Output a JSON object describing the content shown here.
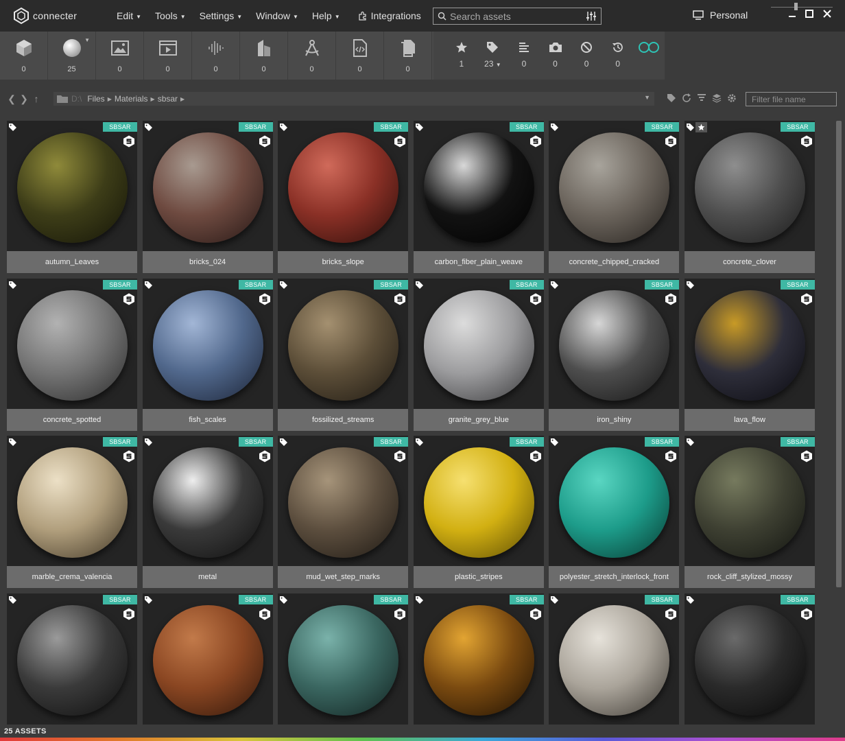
{
  "app": {
    "name": "connecter",
    "menu": [
      {
        "label": "Edit"
      },
      {
        "label": "Tools"
      },
      {
        "label": "Settings"
      },
      {
        "label": "Window"
      },
      {
        "label": "Help"
      }
    ],
    "integrations_label": "Integrations",
    "search_placeholder": "Search assets",
    "account_label": "Personal"
  },
  "toolbar": {
    "categories": [
      {
        "icon": "cube-icon",
        "count": "0"
      },
      {
        "icon": "material-sphere-icon",
        "count": "25"
      },
      {
        "icon": "image-icon",
        "count": "0"
      },
      {
        "icon": "video-icon",
        "count": "0"
      },
      {
        "icon": "audio-icon",
        "count": "0"
      },
      {
        "icon": "building-icon",
        "count": "0"
      },
      {
        "icon": "drafting-compass-icon",
        "count": "0"
      },
      {
        "icon": "code-file-icon",
        "count": "0"
      },
      {
        "icon": "documents-icon",
        "count": "0"
      }
    ],
    "filters": [
      {
        "icon": "star-icon",
        "count": "1"
      },
      {
        "icon": "tag-icon",
        "count": "23"
      },
      {
        "icon": "list-icon",
        "count": "0"
      },
      {
        "icon": "camera-icon",
        "count": "0"
      },
      {
        "icon": "block-icon",
        "count": "0"
      },
      {
        "icon": "history-icon",
        "count": "0"
      },
      {
        "icon": "infinity-icon",
        "count": ""
      }
    ]
  },
  "navigation": {
    "path_hidden": "D:\\",
    "path": [
      "Files",
      "Materials",
      "sbsar"
    ],
    "filter_placeholder": "Filter file name"
  },
  "assets": {
    "badge": "SBSAR",
    "items": [
      {
        "name": "autumn_Leaves",
        "starred": false,
        "c1": "#8f8a3a",
        "c2": "#3d3d18",
        "c3": "#141407"
      },
      {
        "name": "bricks_024",
        "starred": false,
        "c1": "#a89a90",
        "c2": "#6e4a40",
        "c3": "#241614"
      },
      {
        "name": "bricks_slope",
        "starred": false,
        "c1": "#d06a5a",
        "c2": "#8a3026",
        "c3": "#2c0e0a"
      },
      {
        "name": "carbon_fiber_plain_weave",
        "starred": false,
        "c1": "#d8d8d8",
        "c2": "#121212",
        "c3": "#000000"
      },
      {
        "name": "concrete_chipped_cracked",
        "starred": false,
        "c1": "#a8a49c",
        "c2": "#6b645c",
        "c3": "#26221e"
      },
      {
        "name": "concrete_clover",
        "starred": true,
        "c1": "#8e8e8e",
        "c2": "#4e4e4e",
        "c3": "#1a1a1a"
      },
      {
        "name": "concrete_spotted",
        "starred": false,
        "c1": "#b2b2b2",
        "c2": "#747474",
        "c3": "#2a2a2a"
      },
      {
        "name": "fish_scales",
        "starred": false,
        "c1": "#a2b6d6",
        "c2": "#51688c",
        "c3": "#1a2234"
      },
      {
        "name": "fossilized_streams",
        "starred": false,
        "c1": "#a49070",
        "c2": "#5c4e38",
        "c3": "#1e1912"
      },
      {
        "name": "granite_grey_blue",
        "starred": false,
        "c1": "#dcdcdc",
        "c2": "#9c9c9e",
        "c3": "#363638"
      },
      {
        "name": "iron_shiny",
        "starred": false,
        "c1": "#d6d6d6",
        "c2": "#4e4e4e",
        "c3": "#141414"
      },
      {
        "name": "lava_flow",
        "starred": false,
        "c1": "#c89a26",
        "c2": "#2e2e3a",
        "c3": "#0a0a10"
      },
      {
        "name": "marble_crema_valencia",
        "starred": false,
        "c1": "#ece0c6",
        "c2": "#b09e7c",
        "c3": "#3e3424"
      },
      {
        "name": "metal",
        "starred": false,
        "c1": "#eeeeee",
        "c2": "#3a3a3a",
        "c3": "#0e0e0e"
      },
      {
        "name": "mud_wet_step_marks",
        "starred": false,
        "c1": "#a6947a",
        "c2": "#5c4e3e",
        "c3": "#1c1712"
      },
      {
        "name": "plastic_stripes",
        "starred": false,
        "c1": "#f6e070",
        "c2": "#d2b012",
        "c3": "#5a4a04"
      },
      {
        "name": "polyester_stretch_interlock_front",
        "starred": false,
        "c1": "#5ad6c2",
        "c2": "#1d9c8a",
        "c3": "#07382f"
      },
      {
        "name": "rock_cliff_stylized_mossy",
        "starred": false,
        "c1": "#767a5e",
        "c2": "#3e4032",
        "c3": "#121410"
      },
      {
        "name": "",
        "starred": false,
        "c1": "#9a9a9a",
        "c2": "#3a3a3a",
        "c3": "#0e0e0e"
      },
      {
        "name": "",
        "starred": false,
        "c1": "#c27a4a",
        "c2": "#8a4622",
        "c3": "#2e160a"
      },
      {
        "name": "",
        "starred": false,
        "c1": "#7ab2aa",
        "c2": "#3a6660",
        "c3": "#10201e"
      },
      {
        "name": "",
        "starred": false,
        "c1": "#e2a432",
        "c2": "#7a4a10",
        "c3": "#1c0f02"
      },
      {
        "name": "",
        "starred": false,
        "c1": "#e6e2da",
        "c2": "#aaa49a",
        "c3": "#3c3832"
      },
      {
        "name": "",
        "starred": false,
        "c1": "#6a6a6a",
        "c2": "#2a2a2a",
        "c3": "#080808"
      }
    ]
  },
  "status": {
    "text": "25 ASSETS"
  },
  "colors": {
    "accent": "#3fb8a4",
    "infinity": "#2ec4b6",
    "card_bg": "#242424",
    "label_bg": "#6c6c6c"
  }
}
